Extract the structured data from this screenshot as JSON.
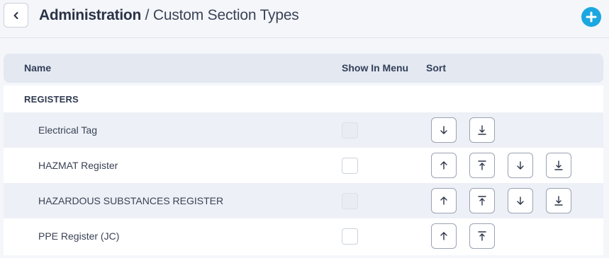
{
  "header": {
    "title_main": "Administration",
    "title_sub": " / Custom Section Types"
  },
  "table": {
    "columns": {
      "name": "Name",
      "show_in_menu": "Show In Menu",
      "sort": "Sort"
    },
    "group_label": "REGISTERS",
    "rows": [
      {
        "name": "Electrical Tag",
        "show_in_menu": false,
        "checkbox_enabled": false
      },
      {
        "name": "HAZMAT Register",
        "show_in_menu": false,
        "checkbox_enabled": true
      },
      {
        "name": "HAZARDOUS SUBSTANCES REGISTER",
        "show_in_menu": false,
        "checkbox_enabled": false
      },
      {
        "name": "PPE Register (JC)",
        "show_in_menu": false,
        "checkbox_enabled": true
      }
    ]
  },
  "icons": {
    "back": "chevron-left-icon",
    "add": "plus-circle-icon",
    "move_up": "arrow-up-icon",
    "move_top": "arrow-to-top-icon",
    "move_down": "arrow-down-icon",
    "move_bottom": "arrow-to-bottom-icon"
  },
  "colors": {
    "accent": "#1ba7e0",
    "text": "#2c3447",
    "header_bg": "#e3e8f1",
    "row_shade": "#edf0f6"
  }
}
